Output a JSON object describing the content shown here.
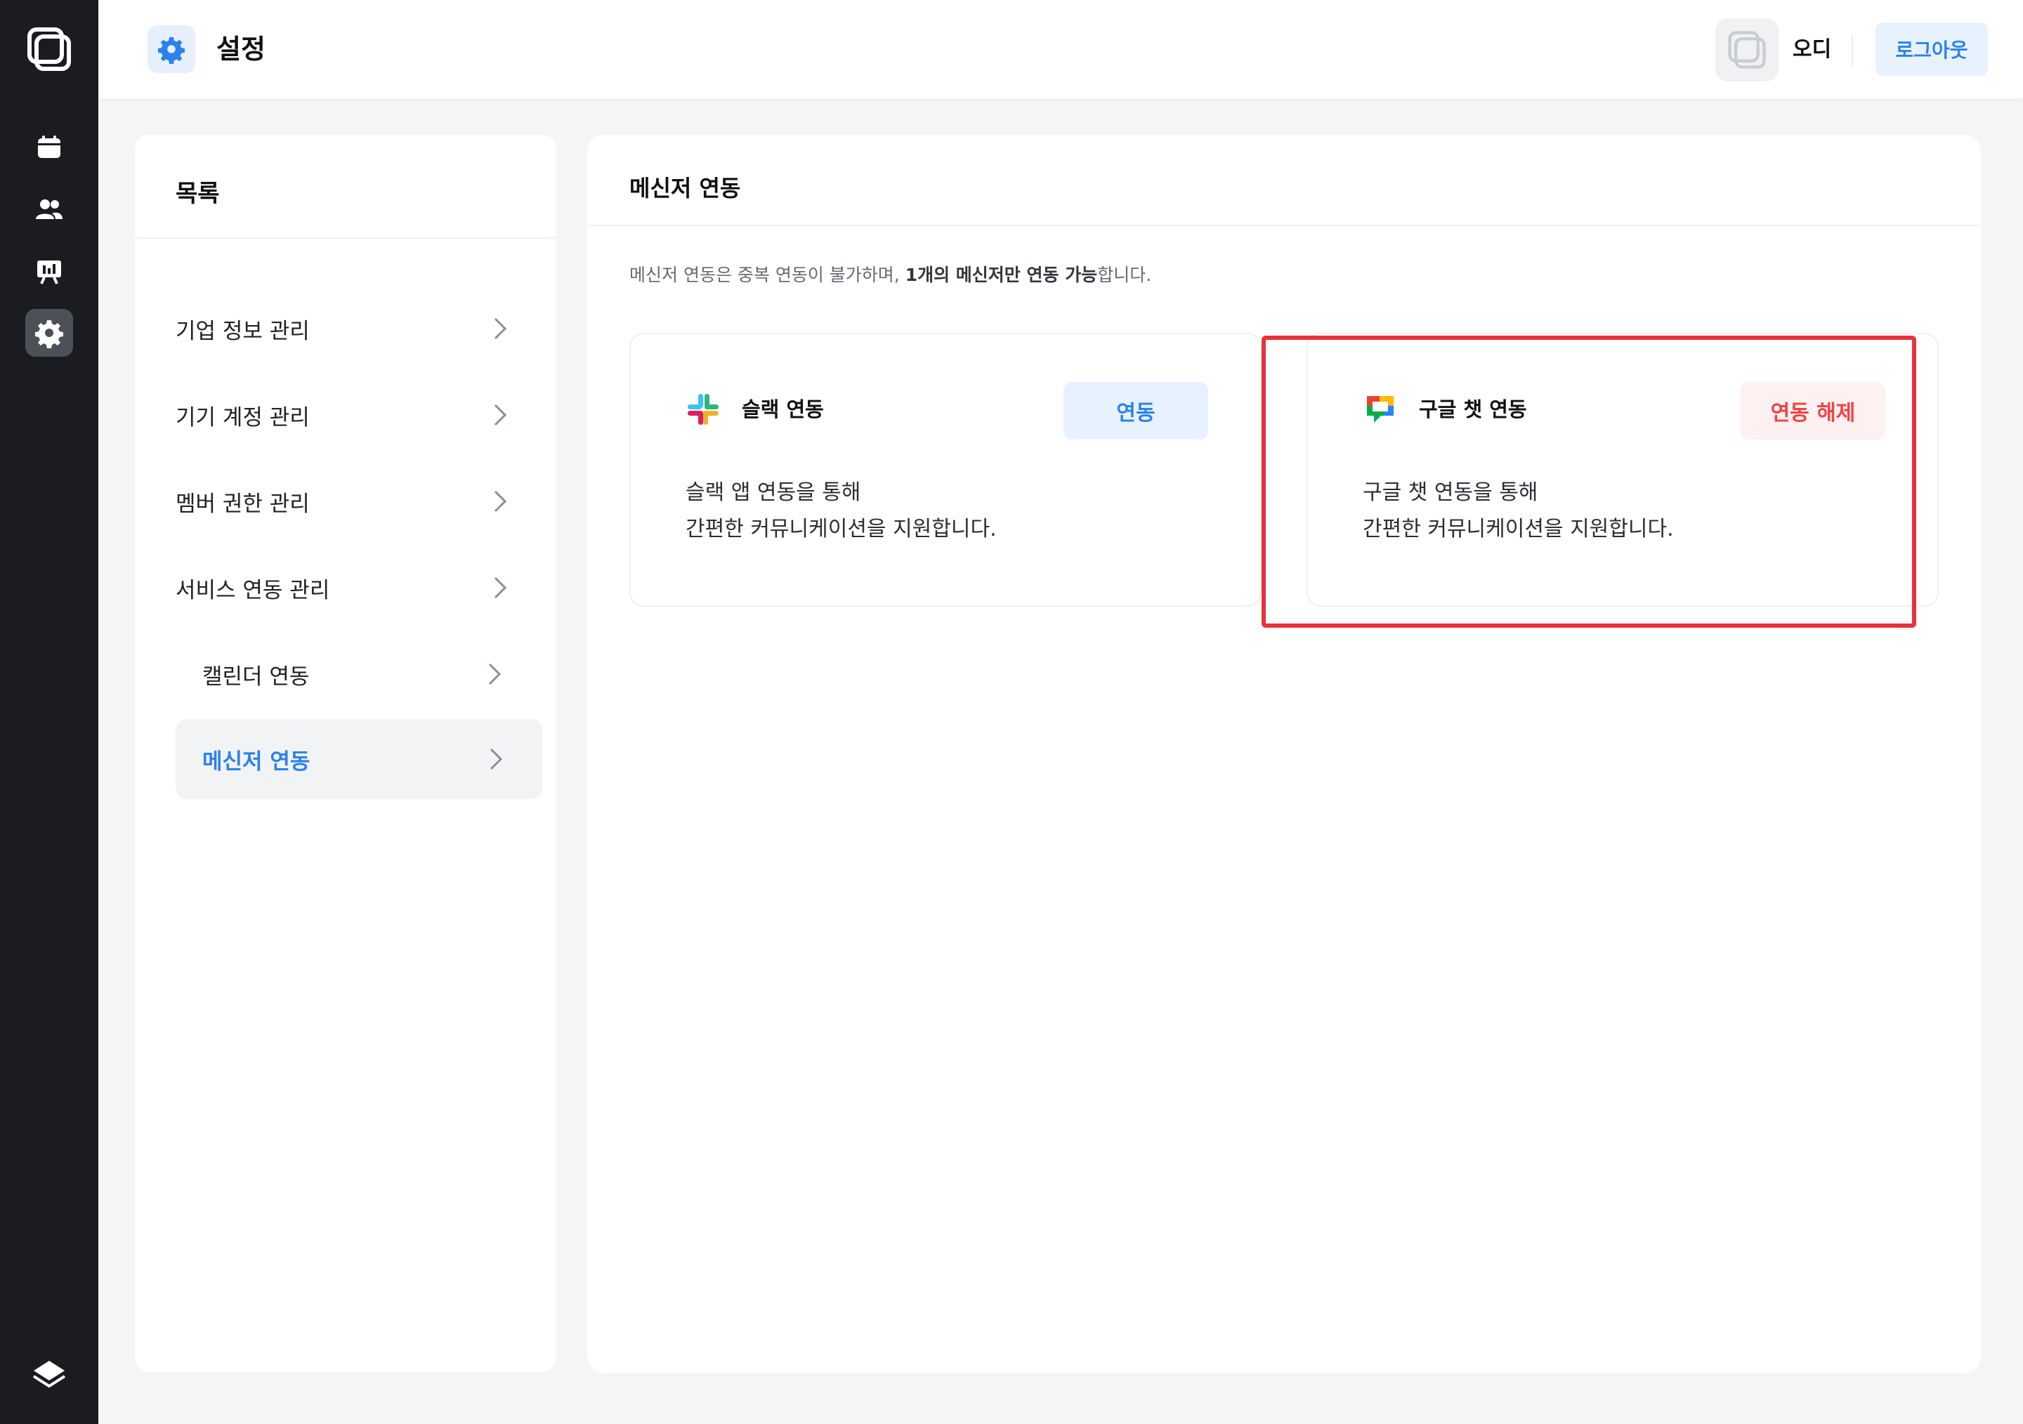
{
  "rail": {
    "items": [
      {
        "icon": "calendar-icon"
      },
      {
        "icon": "people-icon"
      },
      {
        "icon": "presentation-icon"
      },
      {
        "icon": "gear-icon",
        "active": true
      }
    ],
    "bottom_icon": "layers-icon"
  },
  "header": {
    "title": "설정",
    "user_name": "오디",
    "logout_label": "로그아웃"
  },
  "menu": {
    "title": "목록",
    "items": [
      {
        "label": "기업 정보 관리"
      },
      {
        "label": "기기 계정 관리"
      },
      {
        "label": "멤버 권한 관리"
      },
      {
        "label": "서비스 연동 관리"
      },
      {
        "label": "캘린더 연동"
      },
      {
        "label": "메신저 연동"
      }
    ]
  },
  "content": {
    "title": "메신저 연동",
    "notice_prefix": "메신저 연동은 중복 연동이 불가하며, ",
    "notice_bold": "1개의 메신저만 연동 가능",
    "notice_suffix": "합니다.",
    "cards": [
      {
        "title": "슬랙 연동",
        "button": "연동",
        "desc_line1": "슬랙 앱 연동을 통해",
        "desc_line2": "간편한 커뮤니케이션을 지원합니다."
      },
      {
        "title": "구글 챗 연동",
        "button": "연동 해제",
        "desc_line1": "구글 챗 연동을 통해",
        "desc_line2": "간편한 커뮤니케이션을 지원합니다."
      }
    ]
  },
  "colors": {
    "accent": "#2c82ec",
    "danger": "#f04444",
    "rail_bg": "#1b1c1f",
    "highlight": "#e8323a"
  }
}
